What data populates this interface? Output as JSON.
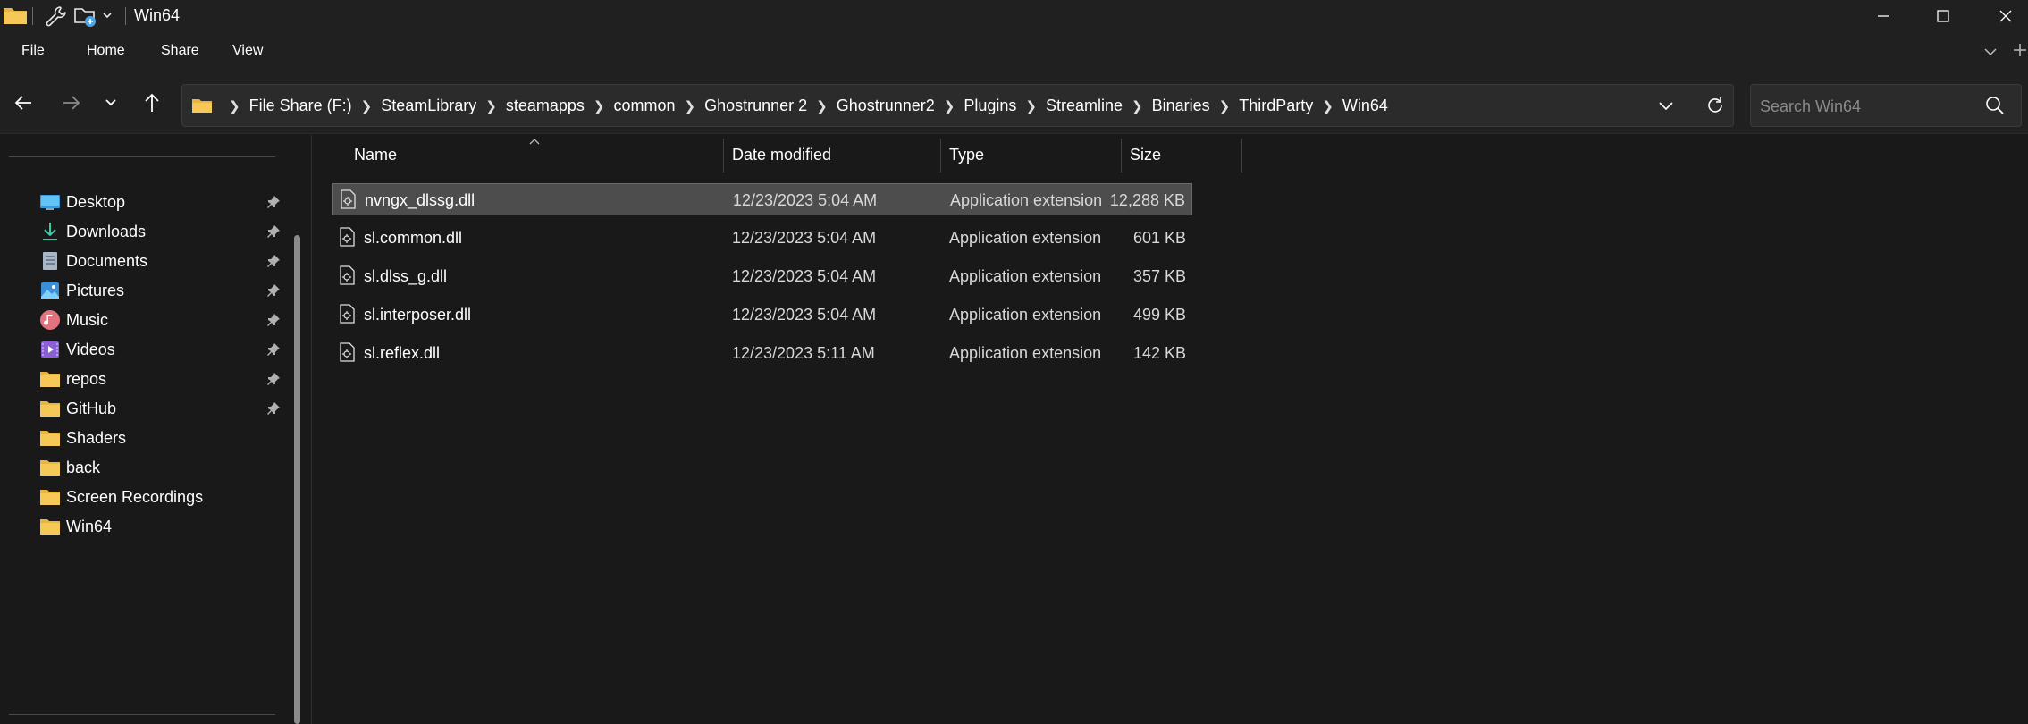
{
  "window": {
    "title": "Win64"
  },
  "menu": {
    "file": "File",
    "home": "Home",
    "share": "Share",
    "view": "View"
  },
  "breadcrumbs": [
    "File Share (F:)",
    "SteamLibrary",
    "steamapps",
    "common",
    "Ghostrunner 2",
    "Ghostrunner2",
    "Plugins",
    "Streamline",
    "Binaries",
    "ThirdParty",
    "Win64"
  ],
  "search": {
    "placeholder": "Search Win64",
    "value": ""
  },
  "sidebar": {
    "items": [
      {
        "label": "Desktop",
        "icon": "desktop-icon",
        "pinned": true
      },
      {
        "label": "Downloads",
        "icon": "download-icon",
        "pinned": true
      },
      {
        "label": "Documents",
        "icon": "document-icon",
        "pinned": true
      },
      {
        "label": "Pictures",
        "icon": "pictures-icon",
        "pinned": true
      },
      {
        "label": "Music",
        "icon": "music-icon",
        "pinned": true
      },
      {
        "label": "Videos",
        "icon": "videos-icon",
        "pinned": true
      },
      {
        "label": "repos",
        "icon": "folder-icon",
        "pinned": true
      },
      {
        "label": "GitHub",
        "icon": "folder-icon",
        "pinned": true
      },
      {
        "label": "Shaders",
        "icon": "folder-icon",
        "pinned": false
      },
      {
        "label": "back",
        "icon": "folder-icon",
        "pinned": false
      },
      {
        "label": "Screen Recordings",
        "icon": "folder-icon",
        "pinned": false
      },
      {
        "label": "Win64",
        "icon": "folder-icon",
        "pinned": false
      }
    ]
  },
  "columns": {
    "name": "Name",
    "date": "Date modified",
    "type": "Type",
    "size": "Size"
  },
  "files": [
    {
      "name": "nvngx_dlssg.dll",
      "date": "12/23/2023 5:04 AM",
      "type": "Application extension",
      "size": "12,288 KB",
      "selected": true
    },
    {
      "name": "sl.common.dll",
      "date": "12/23/2023 5:04 AM",
      "type": "Application extension",
      "size": "601 KB",
      "selected": false
    },
    {
      "name": "sl.dlss_g.dll",
      "date": "12/23/2023 5:04 AM",
      "type": "Application extension",
      "size": "357 KB",
      "selected": false
    },
    {
      "name": "sl.interposer.dll",
      "date": "12/23/2023 5:04 AM",
      "type": "Application extension",
      "size": "499 KB",
      "selected": false
    },
    {
      "name": "sl.reflex.dll",
      "date": "12/23/2023 5:11 AM",
      "type": "Application extension",
      "size": "142 KB",
      "selected": false
    }
  ],
  "colors": {
    "background": "#191919",
    "chrome": "#202020",
    "selected_row": "#4d4d4d",
    "folder": "#f2c14e",
    "text": "#ffffff"
  }
}
